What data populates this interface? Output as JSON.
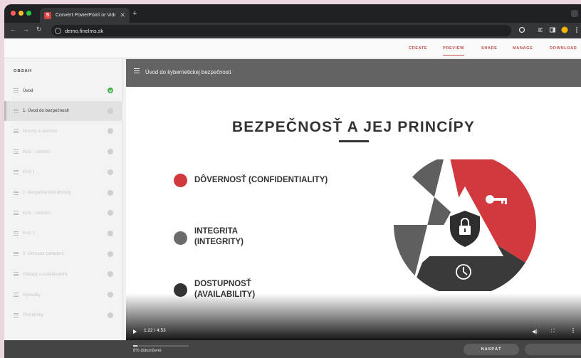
{
  "browser": {
    "tab_title": "Convert PowerPoint or Video",
    "tab_favicon_letter": "S",
    "url": "demo.finelms.sk"
  },
  "topnav": {
    "items": [
      "CREATE",
      "PREVIEW",
      "SHARE",
      "MANAGE",
      "DOWNLOAD"
    ],
    "active": "PREVIEW"
  },
  "sidebar": {
    "heading": "OBSAH",
    "items": [
      {
        "label": "Úvod",
        "status": "done"
      },
      {
        "label": "1. Úvod do bezpečnosti",
        "status": "current"
      },
      {
        "label": "Hrozby a útočníci",
        "status": "todo"
      },
      {
        "label": "Kvíz - útočníci",
        "status": "todo"
      },
      {
        "label": "Kvíz 1",
        "status": "todo"
      },
      {
        "label": "2. Bezpečnostné dôvody",
        "status": "todo"
      },
      {
        "label": "Kvíz - útočníci",
        "status": "todo"
      },
      {
        "label": "Kvíz 2",
        "status": "todo"
      },
      {
        "label": "3. Ochrana zariadení",
        "status": "todo"
      },
      {
        "label": "Odkazy s vzdelávaním",
        "status": "todo"
      },
      {
        "label": "Výsledky",
        "status": "todo"
      },
      {
        "label": "Poznámky",
        "status": "todo"
      }
    ]
  },
  "lesson": {
    "title": "Úvod do kybernetickej bezpečnosti"
  },
  "slide": {
    "title": "BEZPEČNOSŤ A JEJ PRINCÍPY",
    "bullets": [
      {
        "text": "DÔVERNOSŤ (CONFIDENTIALITY)",
        "color": "#d2393f"
      },
      {
        "text": "INTEGRITA\n(INTEGRITY)",
        "color": "#6b6b6b"
      },
      {
        "text": "DOSTUPNOSŤ\n(AVAILABILITY)",
        "color": "#333333"
      }
    ],
    "diagram_icons": [
      "arrows-exchange-icon",
      "key-icon",
      "clock-icon",
      "shield-lock-icon"
    ]
  },
  "player": {
    "time": "1:22 / 4:53"
  },
  "footer": {
    "progress_label": "8% dokončené",
    "progress_fraction": 0.08,
    "back_label": "NASPÄŤ"
  },
  "colors": {
    "accent": "#c0504d",
    "confidentiality": "#d2393f",
    "integrity": "#5f5f5f",
    "availability": "#3a3a3a"
  }
}
